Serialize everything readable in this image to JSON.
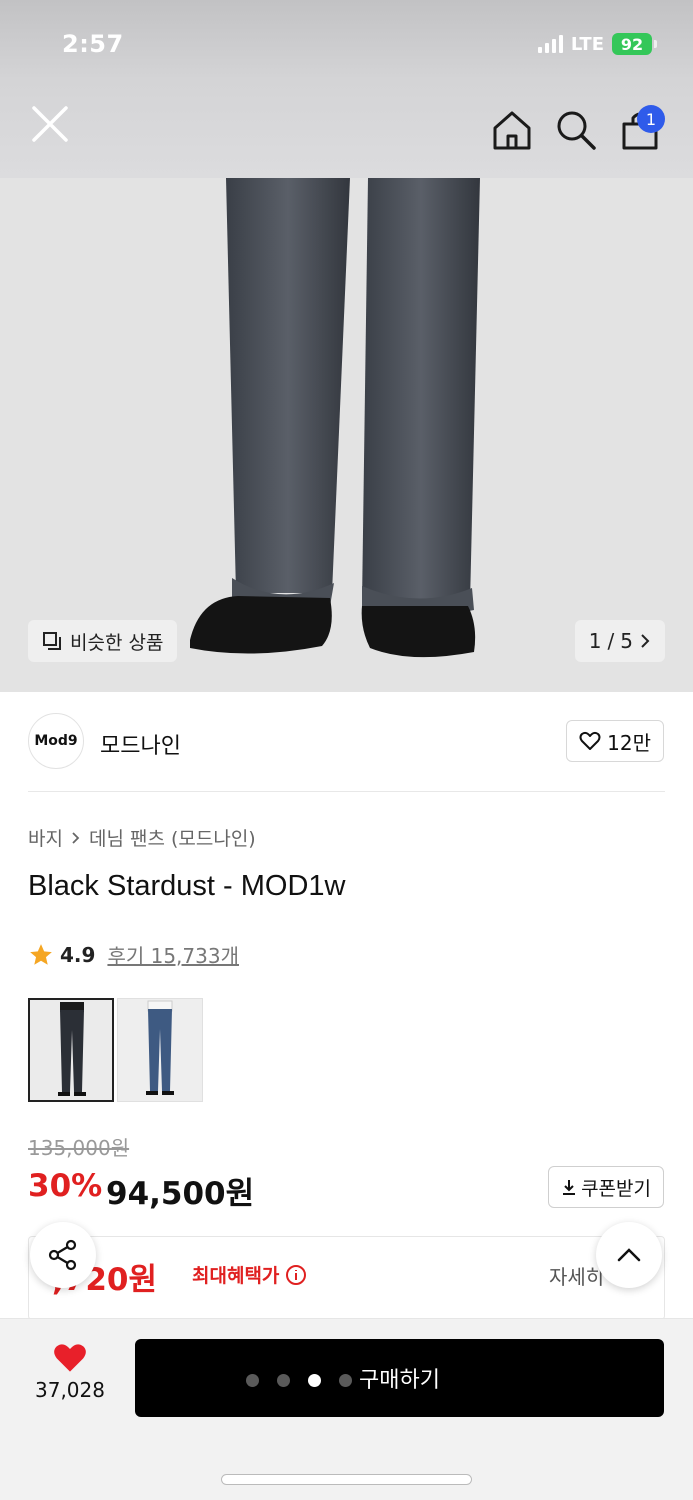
{
  "status_bar": {
    "time": "2:57",
    "network": "LTE",
    "battery": "92"
  },
  "header": {
    "cart_count": "1"
  },
  "gallery": {
    "similar_label": "비슷한 상품",
    "page_current": "1",
    "page_total": "5"
  },
  "brand": {
    "logo_text": "Mod9",
    "name": "모드나인",
    "likes": "12만"
  },
  "product": {
    "breadcrumb": [
      "바지",
      "데님 팬츠 (모드나인)"
    ],
    "title": "Black Stardust - MOD1w",
    "rating": "4.9",
    "review_label": "후기 15,733개",
    "color_options": [
      {
        "name": "black",
        "color": "#2b2f36"
      },
      {
        "name": "blue",
        "color": "#3e5a82"
      }
    ],
    "original_price": "135,000원",
    "discount": "30%",
    "price": "94,500원",
    "coupon_label": "쿠폰받기"
  },
  "benefit": {
    "price": ",720원",
    "label": "최대혜택가",
    "detail_label": "자세히"
  },
  "bottom_bar": {
    "wish_count": "37,028",
    "buy_label": "구매하기"
  },
  "carousel_dots": {
    "count": 4,
    "active": 3
  },
  "colors": {
    "accent_red": "#e02020",
    "badge_blue": "#2f5bea",
    "heart_red": "#e8202a",
    "buy_black": "#000000"
  }
}
